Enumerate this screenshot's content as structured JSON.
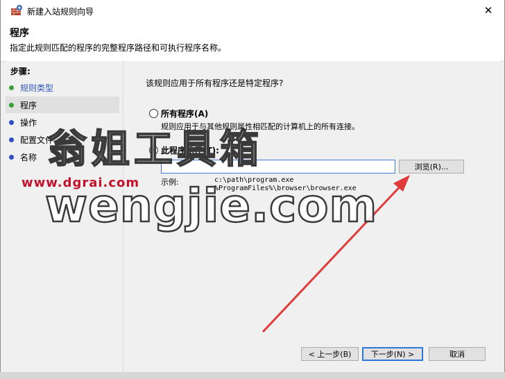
{
  "window": {
    "title": "新建入站规则向导",
    "close_glyph": "✕"
  },
  "header": {
    "title": "程序",
    "description": "指定此规则匹配的程序的完整程序路径和可执行程序名称。"
  },
  "steps": {
    "title": "步骤:",
    "items": [
      {
        "label": "规则类型",
        "state": "done"
      },
      {
        "label": "程序",
        "state": "current"
      },
      {
        "label": "操作",
        "state": "todo"
      },
      {
        "label": "配置文件",
        "state": "todo"
      },
      {
        "label": "名称",
        "state": "todo"
      }
    ]
  },
  "content": {
    "question": "该规则应用于所有程序还是特定程序?",
    "option_all": {
      "label": "所有程序(A)",
      "description": "规则应用于与其他规则属性相匹配的计算机上的所有连接。",
      "selected": false
    },
    "option_path": {
      "label": "此程序路径(T):",
      "selected": true,
      "input_value": "",
      "browse_label": "浏览(R)..."
    },
    "example_label": "示例:",
    "example_text": "c:\\path\\program.exe\n%ProgramFiles%\\browser\\browser.exe"
  },
  "footer": {
    "back_label": "< 上一步(B)",
    "next_label": "下一步(N) >",
    "cancel_label": "取消"
  },
  "watermark": {
    "line1": "翁姐工具箱",
    "url": "www.dgrai.com",
    "line2": "wengjie.com"
  },
  "colors": {
    "accent": "#2a78d4",
    "arrow": "#e03a3a",
    "done_dot": "#3aa13a",
    "todo_dot": "#2f4fc7",
    "watermark_red": "#c4122d"
  }
}
